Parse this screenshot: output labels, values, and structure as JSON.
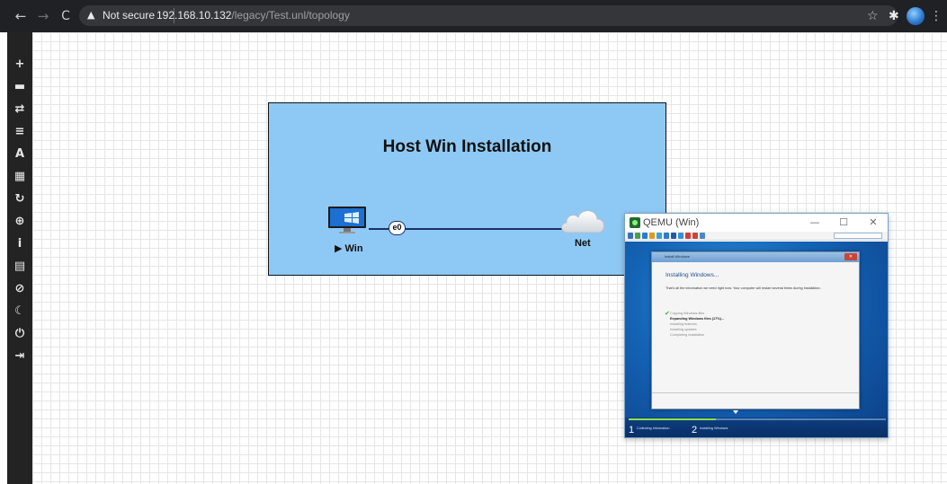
{
  "browser": {
    "security_label": "Not secure",
    "url_host": "192.168.10.132",
    "url_path": "/legacy/Test.unl/topology",
    "nav_back_glyph": "←",
    "nav_forward_glyph": "→",
    "reload_glyph": "C",
    "icons": [
      "back-arrow-icon",
      "forward-arrow-icon",
      "reload-icon",
      "warning-triangle-icon",
      "star-icon",
      "puzzle-extension-icon",
      "profile-avatar",
      "kebab-menu-icon"
    ]
  },
  "sidebar": {
    "tools": [
      {
        "name": "add-object-icon",
        "glyph": "+"
      },
      {
        "name": "nodes-icon",
        "glyph": "▬"
      },
      {
        "name": "networks-icon",
        "glyph": "⇄"
      },
      {
        "name": "startup-configs-icon",
        "glyph": "≡"
      },
      {
        "name": "text-objects-icon",
        "glyph": "A"
      },
      {
        "name": "grid-icon",
        "glyph": "▦"
      },
      {
        "name": "refresh-icon",
        "glyph": "↻"
      },
      {
        "name": "zoom-icon",
        "glyph": "⊕"
      },
      {
        "name": "info-icon",
        "glyph": "i"
      },
      {
        "name": "notes-icon",
        "glyph": "▤"
      },
      {
        "name": "lock-icon",
        "glyph": "⊘"
      },
      {
        "name": "dark-mode-icon",
        "glyph": "☾"
      },
      {
        "name": "power-icon",
        "glyph": "⏻"
      },
      {
        "name": "logout-icon",
        "glyph": "⇥"
      }
    ]
  },
  "topology": {
    "title": "Host Win Installation",
    "node_label": "▶ Win",
    "interface_label": "e0",
    "network_label": "Net",
    "box_color": "#8ec9f5",
    "link_color": "#1a2f6b"
  },
  "qemu": {
    "window_title": "QEMU (Win)",
    "min_glyph": "—",
    "max_glyph": "☐",
    "close_glyph": "✕",
    "toolbar_colors": [
      "#3d6fb5",
      "#4a9f4a",
      "#2b7bd0",
      "#e29a1f",
      "#3aa0d8",
      "#2e7bcf",
      "#1e5aa8",
      "#3c8fd3",
      "#d33c3c",
      "#c9453a",
      "#4a88c8"
    ]
  },
  "setup": {
    "window_title": "Install Windows",
    "close_glyph": "✕",
    "heading": "Installing Windows...",
    "description": "That's all the information we need right now. Your computer will restart several times during installation.",
    "check_glyph": "✔",
    "steps": [
      "Copying Windows files",
      "Expanding Windows files (17%)...",
      "Installing features",
      "Installing updates",
      "Completing installation"
    ],
    "phase_1_number": "1",
    "phase_1_label": "Collecting information",
    "phase_2_number": "2",
    "phase_2_label": "Installing Windows",
    "phase_progress": 0.34
  }
}
